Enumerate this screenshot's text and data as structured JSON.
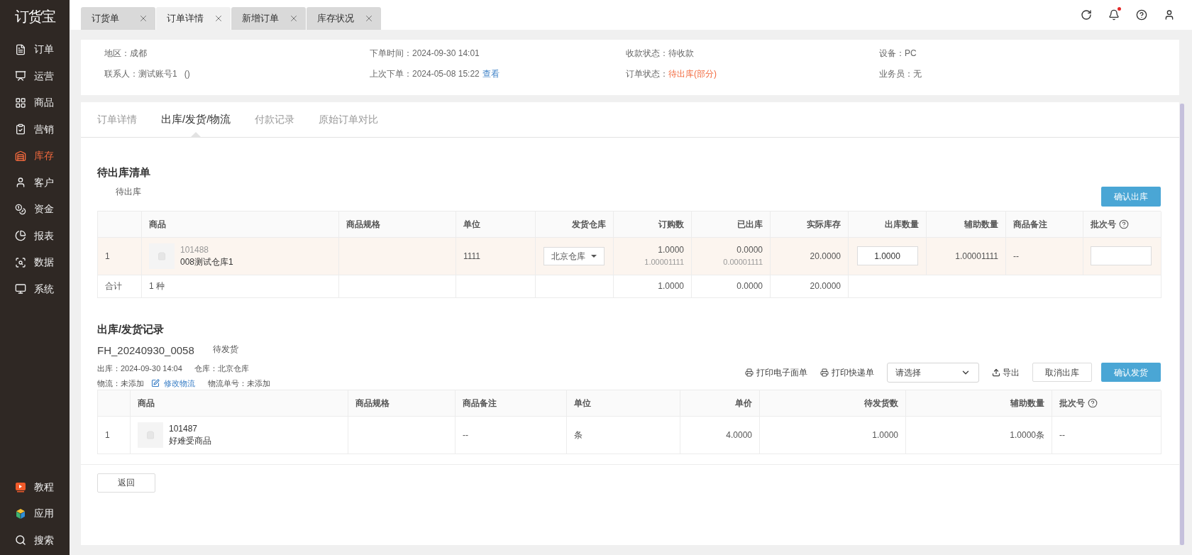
{
  "app": {
    "logo": "订货宝"
  },
  "sidebar": {
    "items": [
      {
        "label": "订单",
        "selected": false
      },
      {
        "label": "运营",
        "selected": false
      },
      {
        "label": "商品",
        "selected": false
      },
      {
        "label": "营销",
        "selected": false
      },
      {
        "label": "库存",
        "selected": true
      },
      {
        "label": "客户",
        "selected": false
      },
      {
        "label": "资金",
        "selected": false
      },
      {
        "label": "报表",
        "selected": false
      },
      {
        "label": "数据",
        "selected": false
      },
      {
        "label": "系统",
        "selected": false
      }
    ],
    "bottom_items": [
      {
        "label": "教程"
      },
      {
        "label": "应用"
      },
      {
        "label": "搜索"
      }
    ]
  },
  "tabs": [
    {
      "label": "订货单",
      "selected": false
    },
    {
      "label": "订单详情",
      "selected": true
    },
    {
      "label": "新增订单",
      "selected": false
    },
    {
      "label": "库存状况",
      "selected": false
    }
  ],
  "notifications": {
    "unread": true
  },
  "order_info": {
    "rows": [
      [
        {
          "label": "地区：",
          "value": "成都",
          "warning": false
        },
        {
          "label": "下单时间：",
          "value": "2024-09-30 14:01",
          "warning": false
        },
        {
          "label": "收款状态：",
          "value": "待收款",
          "warning": false
        },
        {
          "label": "设备：",
          "value": "PC",
          "warning": false
        }
      ],
      [
        {
          "label": "联系人：",
          "value": "测试账号1",
          "note": "()",
          "warning": false
        },
        {
          "label": "上次下单：",
          "value": "2024-05-08 15:22",
          "link": "查看",
          "warning": false
        },
        {
          "label": "订单状态：",
          "value": "待出库(部分)",
          "warning": true
        },
        {
          "label": "业务员：",
          "value": "无",
          "warning": false
        }
      ]
    ]
  },
  "detail_tabs": [
    {
      "label": "订单详情",
      "selected": false
    },
    {
      "label": "出库/发货/物流",
      "selected": true
    },
    {
      "label": "付款记录",
      "selected": false
    },
    {
      "label": "原始订单对比",
      "selected": false
    }
  ],
  "pending": {
    "title": "待出库清单",
    "subtitle": "待出库",
    "confirm_button": "确认出库",
    "columns": [
      {
        "label": "商品"
      },
      {
        "label": "商品规格"
      },
      {
        "label": "单位"
      },
      {
        "label": "发货仓库"
      },
      {
        "label": "订购数"
      },
      {
        "label": "已出库"
      },
      {
        "label": "实际库存"
      },
      {
        "label": "出库数量"
      },
      {
        "label": "辅助数量"
      },
      {
        "label": "商品备注"
      },
      {
        "label": "批次号",
        "help": true
      }
    ],
    "rows": [
      {
        "index": "1",
        "highlighted": true,
        "sku": "101488",
        "name": "008测试仓库1",
        "unit": "1111",
        "warehouse": "北京仓库",
        "ordered": "1.0000",
        "ordered_aux": "1.00001111",
        "shipped": "0.0000",
        "shipped_aux": "0.00001111",
        "stock": "20.0000",
        "out_qty": "1.0000",
        "aux_qty": "1.00001111",
        "remark": "--"
      }
    ],
    "total": {
      "label": "合计",
      "kinds": "1 种",
      "ordered": "1.0000",
      "shipped": "0.0000",
      "stock": "20.0000"
    }
  },
  "records": {
    "title": "出库/发货记录",
    "shipment": {
      "code": "FH_20240930_0058",
      "status": "待发货",
      "out": "出库：2024-09-30 14:04",
      "warehouse": "仓库：北京仓库",
      "logistics": "物流：未添加",
      "edit_link": "修改物流",
      "tracking": "物流单号：未添加"
    },
    "actions": {
      "print_waybill": "打印电子面单",
      "print_express": "打印快递单",
      "select_value": "请选择",
      "export": "导出",
      "cancel": "取消出库",
      "confirm": "确认发货"
    },
    "columns": [
      {
        "label": "商品"
      },
      {
        "label": "商品规格"
      },
      {
        "label": "商品备注"
      },
      {
        "label": "单位"
      },
      {
        "label": "单价"
      },
      {
        "label": "待发货数"
      },
      {
        "label": "辅助数量"
      },
      {
        "label": "批次号",
        "help": true
      }
    ],
    "rows": [
      {
        "index": "1",
        "sku": "101487",
        "name": "好难受商品",
        "remark": "--",
        "unit": "条",
        "price": "4.0000",
        "pending_qty": "1.0000",
        "aux_qty": "1.0000条",
        "batch": "--"
      }
    ]
  },
  "back_button": "返回"
}
